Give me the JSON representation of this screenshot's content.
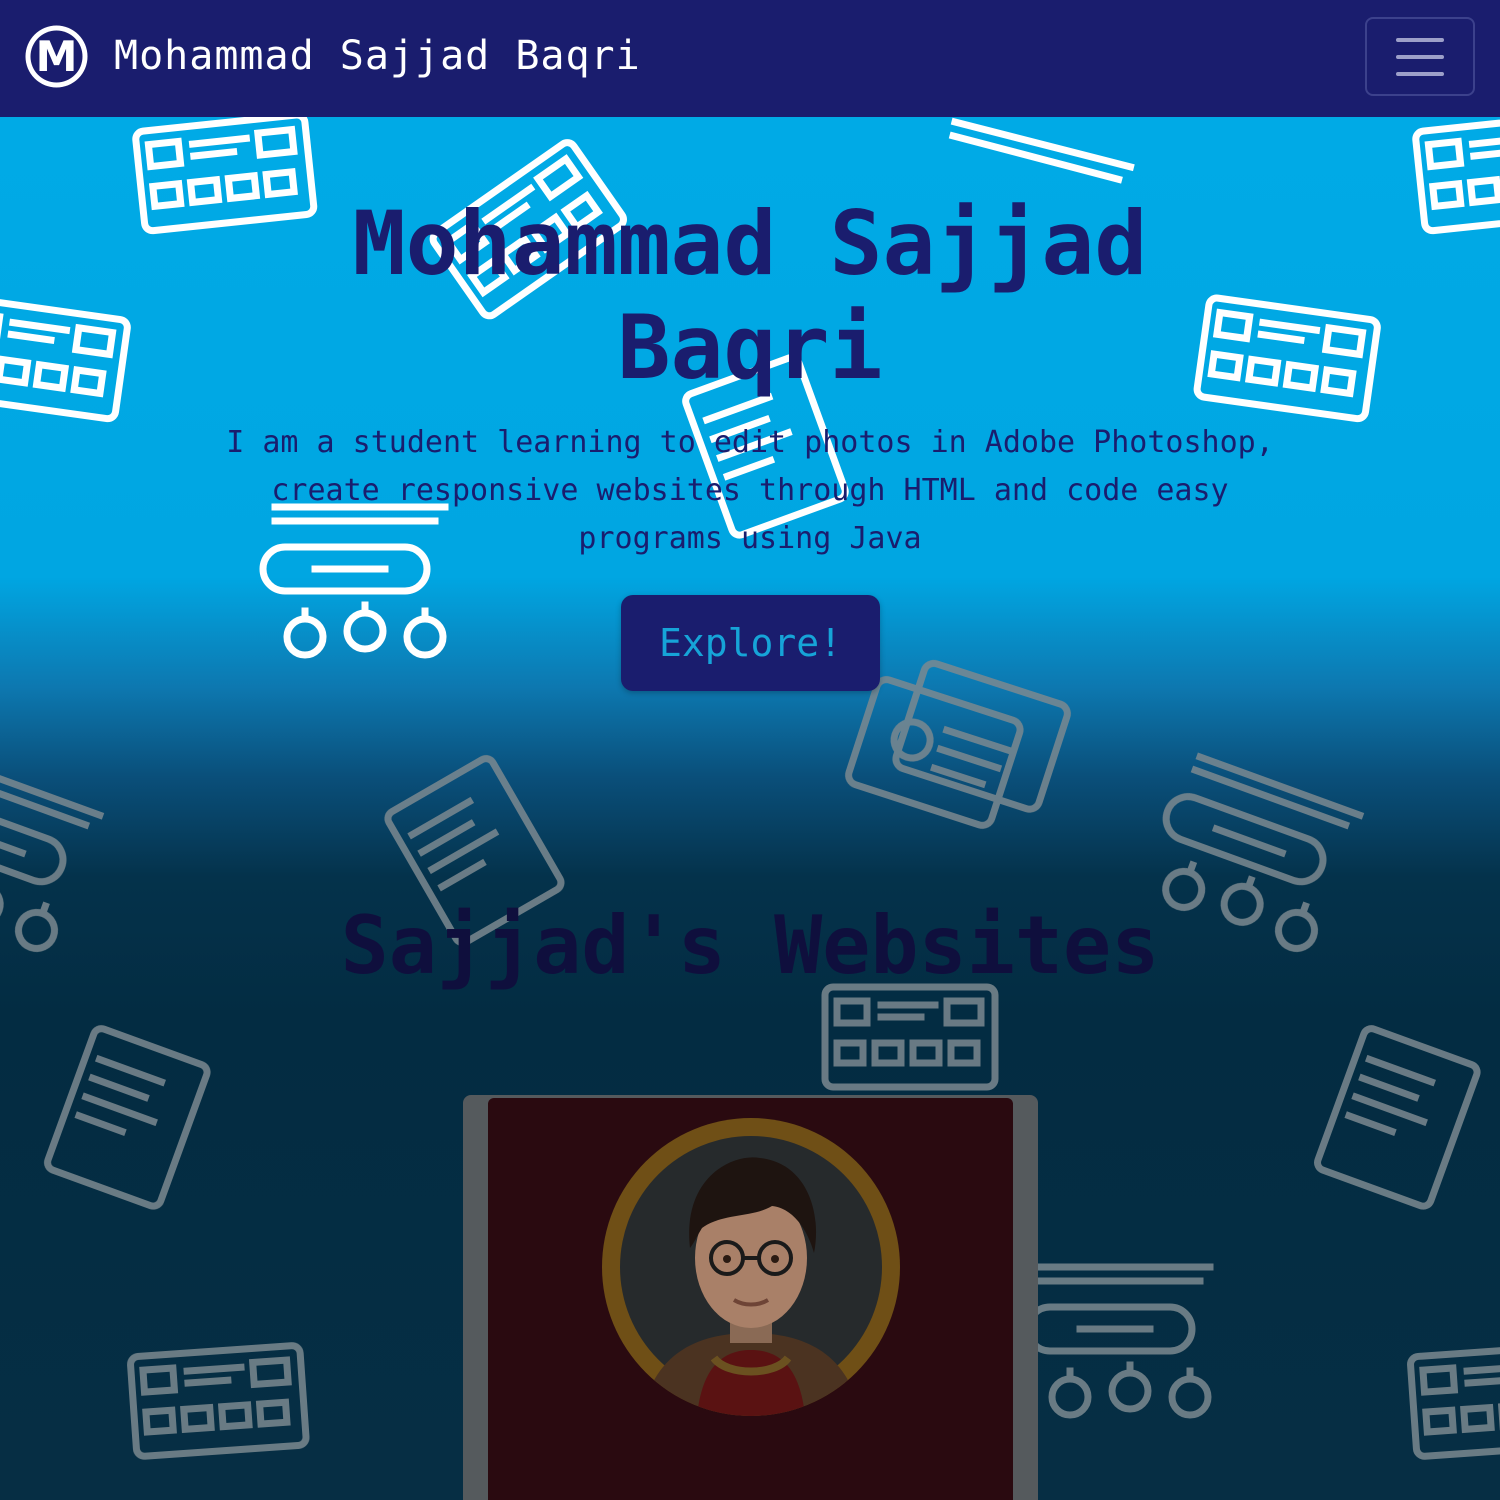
{
  "navbar": {
    "logo_letter": "M",
    "brand": "Mohammad Sajjad Baqri",
    "menu_icon": "hamburger-menu-icon",
    "colors": {
      "background": "#1a1d6e",
      "text": "#ffffff"
    }
  },
  "hero": {
    "title": "Mohammad Sajjad Baqri",
    "subtitle": "I am a student learning to edit photos in Adobe Photoshop, create responsive websites through HTML and code easy programs using Java",
    "button_label": "Explore!",
    "colors": {
      "background": "#00aae6",
      "title": "#1a1d6e",
      "button": "#1a1d6e",
      "button_text": "#16a4d8"
    }
  },
  "websites": {
    "title": "Sajjad's Websites",
    "card": {
      "avatar_icon": "profile-photo",
      "colors": {
        "card": "#2a0a10",
        "avatar_ring": "#6f4f16"
      }
    }
  },
  "background_pattern": {
    "icons": [
      "code-window-icon",
      "binary-code-icon",
      "wrench-gears-icon",
      "webpage-layout-icon",
      "design-tools-icon"
    ]
  }
}
